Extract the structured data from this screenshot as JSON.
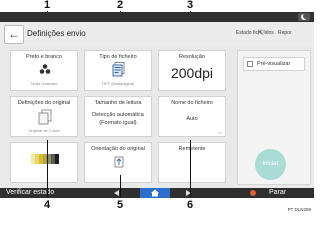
{
  "callouts": {
    "n1": "1",
    "n2": "2",
    "n3": "3",
    "n4": "4",
    "n5": "5",
    "n6": "6"
  },
  "header": {
    "title": "Definições envio",
    "status_link": "Estado fich. lidos",
    "reset_label": "Repor"
  },
  "tiles": {
    "color": {
      "label": "Preto e branco",
      "sub": "Texto Desenho"
    },
    "filetype": {
      "label": "Tipo de ficheiro",
      "sub": "TIFF (Multipágina)"
    },
    "resolution": {
      "label": "Resolução",
      "value": "200dpi"
    },
    "original_settings": {
      "label": "Definições do original",
      "sub": "Original de 1 face"
    },
    "scan_size": {
      "label": "Tamanho de leitura",
      "value": "Detecção automática (Formato igual)"
    },
    "file_name": {
      "label": "Nome do ficheiro",
      "value": "Auto"
    },
    "orientation": {
      "label": "Orientação do original"
    },
    "sender": {
      "label": "Remetente"
    }
  },
  "side_panel": {
    "preview_label": "Pré-visualizar",
    "start_label": "Iniciar"
  },
  "bottom_bar": {
    "verify_label": "Verificar estado",
    "stop_label": "Parar"
  },
  "figure_code": "PT DLN259",
  "colors": {
    "start_button": "#a9dcd4",
    "home_button": "#2a6fcc",
    "stop_icon": "#e0612b"
  }
}
